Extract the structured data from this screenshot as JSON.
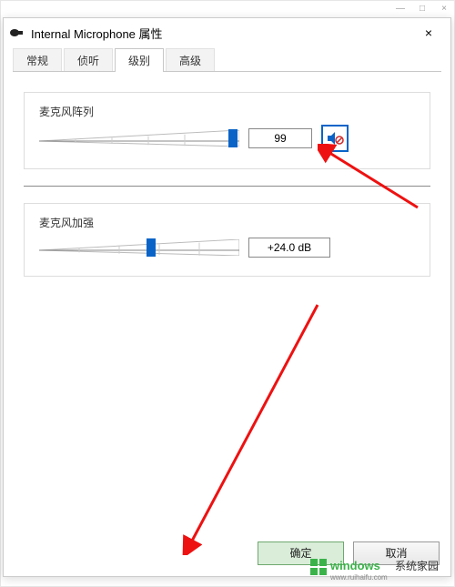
{
  "outer_window": {
    "minimize": "—",
    "maximize": "□",
    "close": "×"
  },
  "dialog": {
    "title": "Internal Microphone 属性",
    "close_symbol": "×",
    "tabs": {
      "general": "常规",
      "listen": "侦听",
      "levels": "级别",
      "advanced": "高级",
      "active": "levels"
    },
    "mic_array": {
      "label": "麦克风阵列",
      "value": "99",
      "slider_percent": 99,
      "muted": true
    },
    "mic_boost": {
      "label": "麦克风加强",
      "value": "+24.0 dB",
      "slider_percent": 55
    },
    "buttons": {
      "ok": "确定",
      "cancel": "取消"
    }
  },
  "watermark": {
    "brand": "windows",
    "suffix": "系统家园",
    "url": "www.ruihaifu.com"
  }
}
